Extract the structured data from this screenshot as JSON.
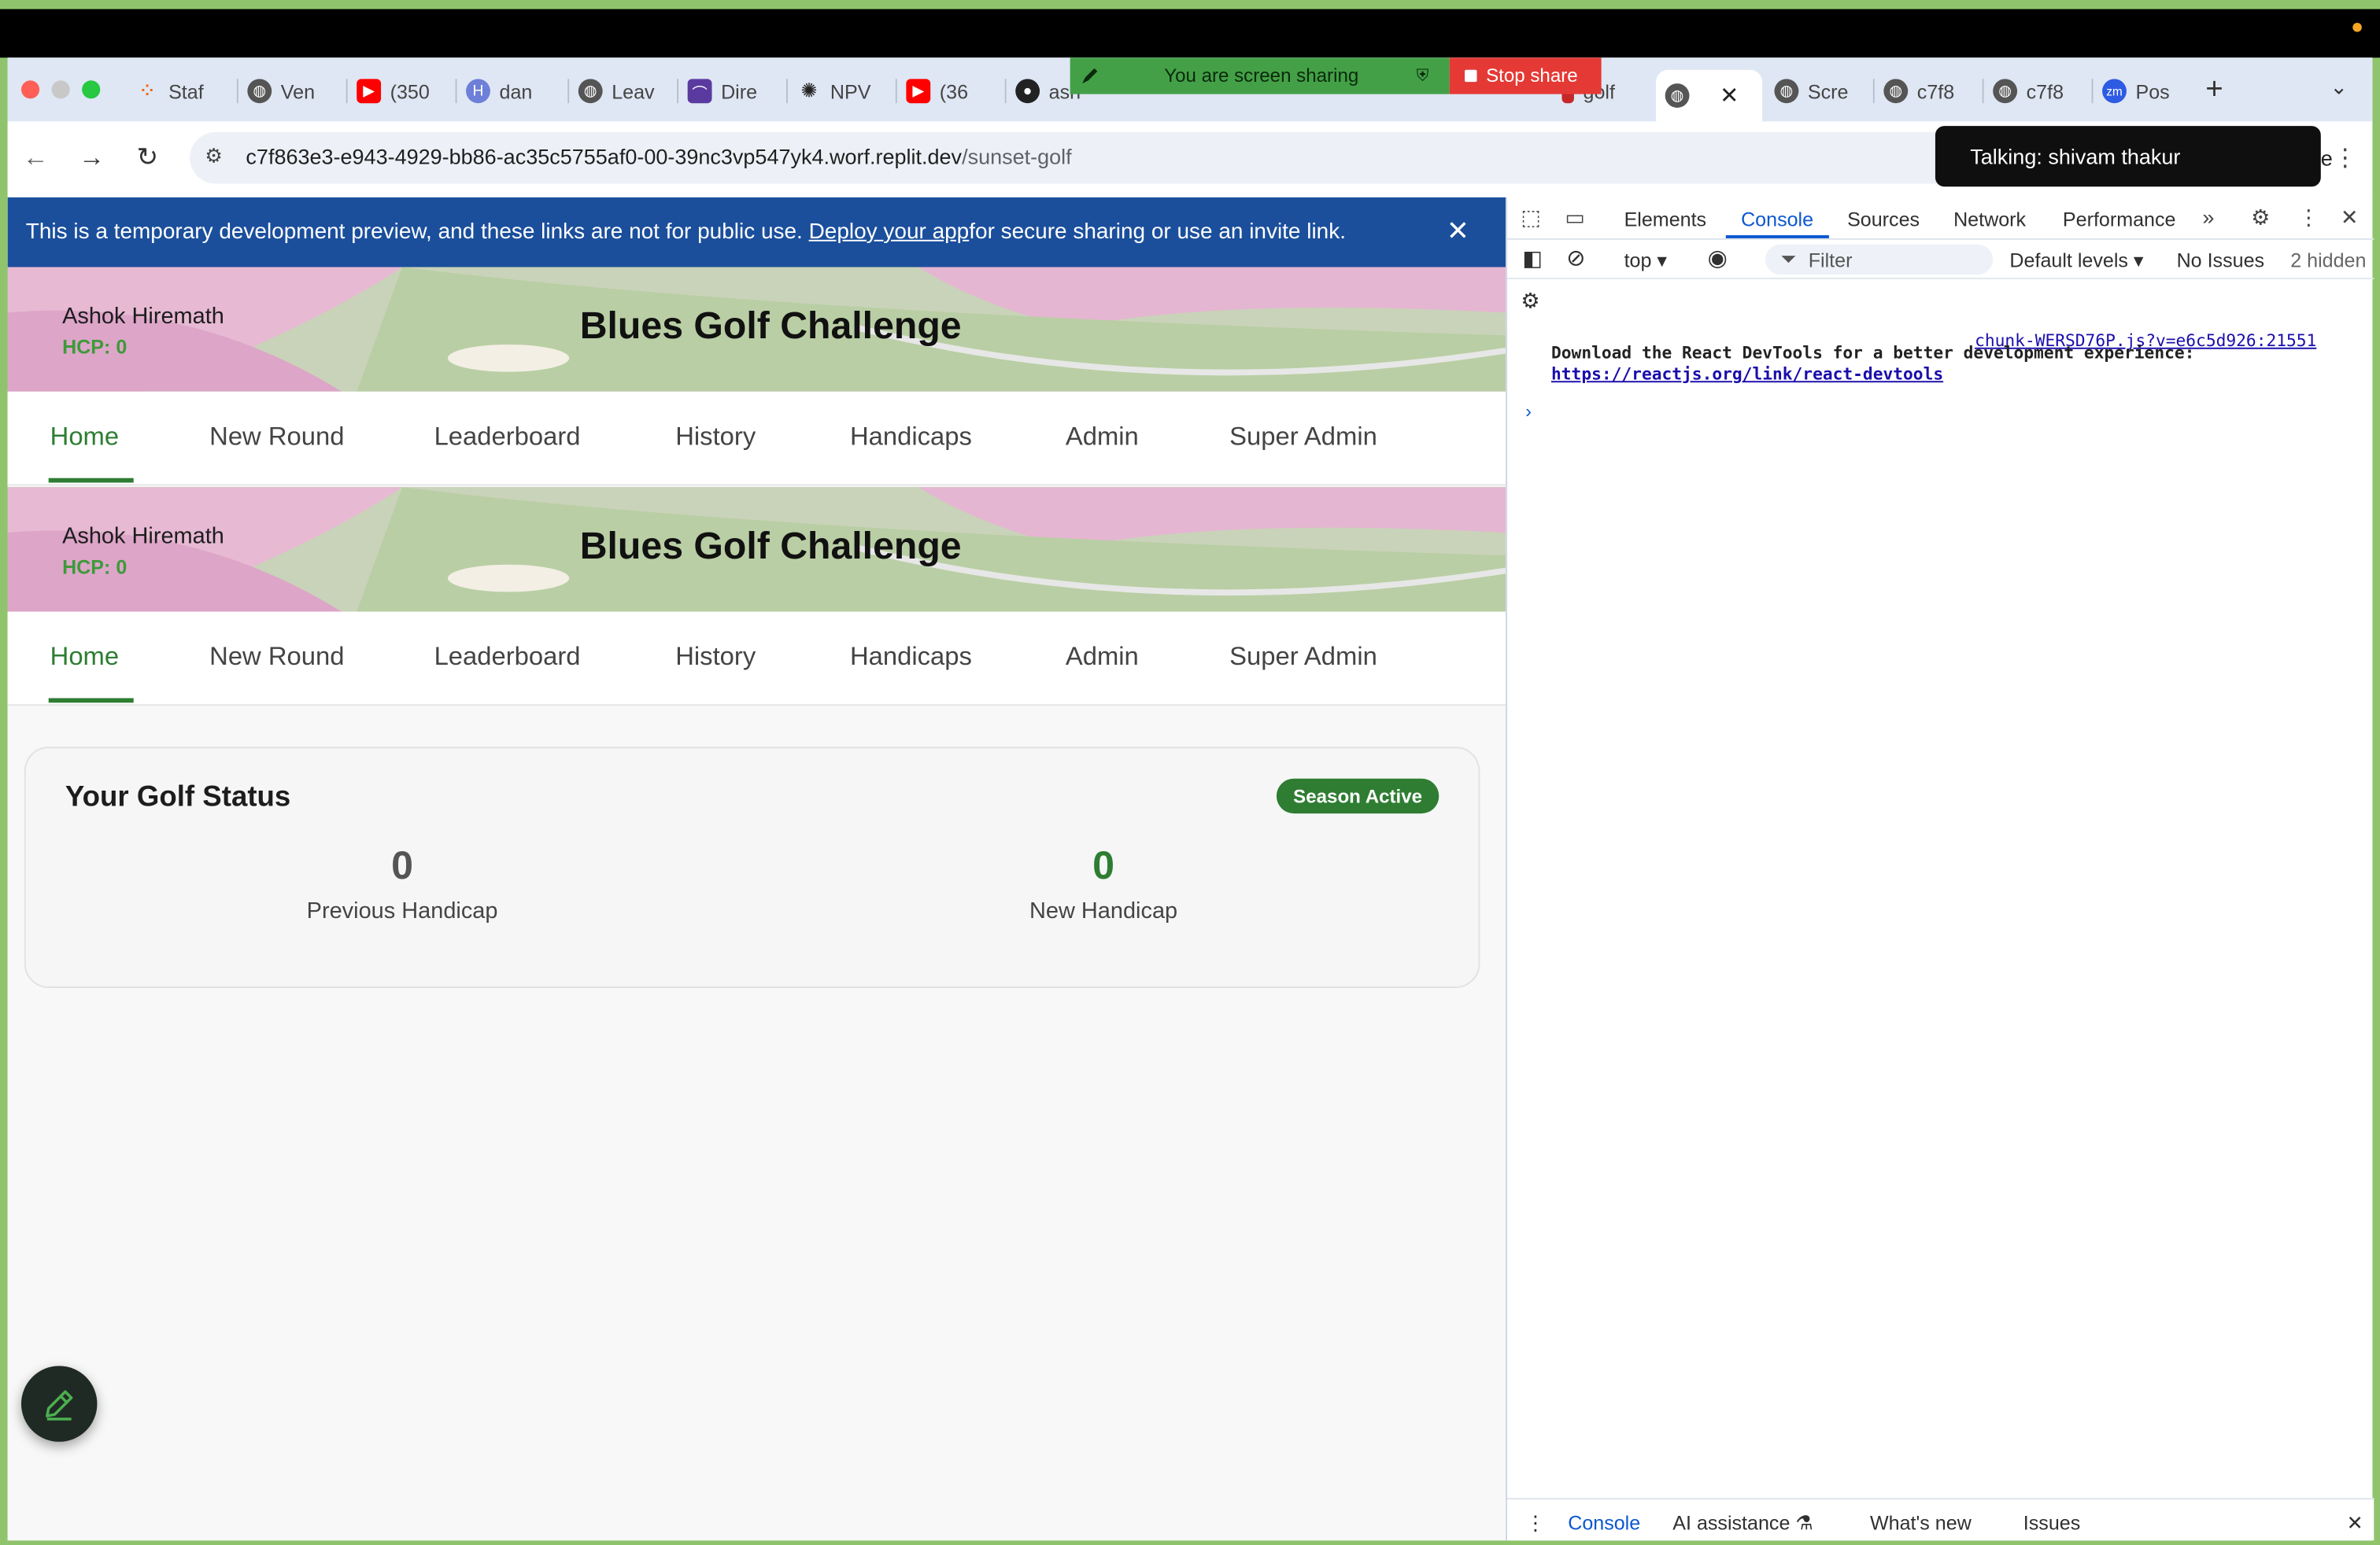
{
  "colors": {
    "accent_green": "#2e7d32",
    "devbanner": "#1b4f9c",
    "share_green": "#43a047",
    "stop_red": "#e53935"
  },
  "screen_share": {
    "label": "You are screen sharing",
    "stop_label": "Stop share"
  },
  "tabs": [
    {
      "label": "Staf",
      "icon": "replit-icon"
    },
    {
      "label": "Ven",
      "icon": "globe-icon"
    },
    {
      "label": "(350",
      "icon": "youtube-icon"
    },
    {
      "label": "dan",
      "icon": "h-icon"
    },
    {
      "label": "Leav",
      "icon": "globe-icon"
    },
    {
      "label": "Dire",
      "icon": "rss-icon"
    },
    {
      "label": "NPV",
      "icon": "openai-icon"
    },
    {
      "label": "(36",
      "icon": "youtube-icon"
    },
    {
      "label": "ash",
      "icon": "github-icon"
    },
    {
      "label": "golf",
      "icon": "golf-icon"
    },
    {
      "label": "",
      "icon": "globe-icon"
    },
    {
      "label": "Scre",
      "icon": "globe-icon"
    },
    {
      "label": "c7f8",
      "icon": "globe-icon"
    },
    {
      "label": "c7f8",
      "icon": "globe-icon"
    },
    {
      "label": "Pos",
      "icon": "zoom-icon"
    }
  ],
  "address": {
    "host": "c7f863e3-e943-4929-bb86-ac35c5755af0-00-39nc3vp547yk4.worf.replit.dev",
    "path": "/sunset-golf"
  },
  "talking": "Talking: shivam thakur",
  "devbanner": {
    "text_before": "This is a temporary development preview, and these links are not for public use. ",
    "link": "Deploy your app",
    "text_after": " for secure sharing or use an invite link."
  },
  "header": {
    "user_name": "Ashok Hiremath",
    "hcp": "HCP: 0",
    "title": "Blues Golf Challenge"
  },
  "nav": [
    "Home",
    "New Round",
    "Leaderboard",
    "History",
    "Handicaps",
    "Admin",
    "Super Admin"
  ],
  "status": {
    "title": "Your Golf Status",
    "badge": "Season Active",
    "previous_value": "0",
    "previous_label": "Previous Handicap",
    "new_value": "0",
    "new_label": "New Handicap"
  },
  "devtools": {
    "tabs": [
      "Elements",
      "Console",
      "Sources",
      "Network",
      "Performance"
    ],
    "context": "top",
    "filter_placeholder": "Filter",
    "levels": "Default levels",
    "issues": "No Issues",
    "hidden": "2 hidden",
    "source": "chunk-WERSD76P.js?v=e6c5d926:21551",
    "message": "Download the React DevTools for a better development experience:",
    "link": "https://reactjs.org/link/react-devtools",
    "drawer": [
      "Console",
      "AI assistance",
      "What's new",
      "Issues"
    ]
  }
}
